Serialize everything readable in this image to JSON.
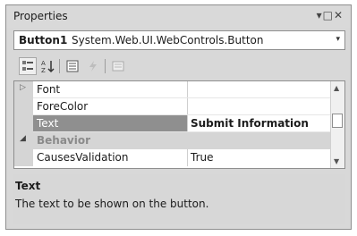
{
  "window": {
    "title": "Properties",
    "controls": "▾□✕"
  },
  "object_selector": {
    "name": "Button1",
    "type": "System.Web.UI.WebControls.Button",
    "arrow": "▾"
  },
  "toolbar": {
    "icons": [
      "categorized-icon",
      "alphabetical-icon",
      "properties-icon",
      "events-icon",
      "property-pages-icon"
    ]
  },
  "grid": {
    "rows": [
      {
        "name": "Font",
        "value": "",
        "expander": "▷"
      },
      {
        "name": "ForeColor",
        "value": ""
      },
      {
        "name": "Text",
        "value": "Submit Information"
      },
      {
        "name": "Behavior",
        "value": "",
        "expander": "◢"
      },
      {
        "name": "CausesValidation",
        "value": "True"
      }
    ]
  },
  "description": {
    "title": "Text",
    "text": "The text to be shown on the button."
  }
}
